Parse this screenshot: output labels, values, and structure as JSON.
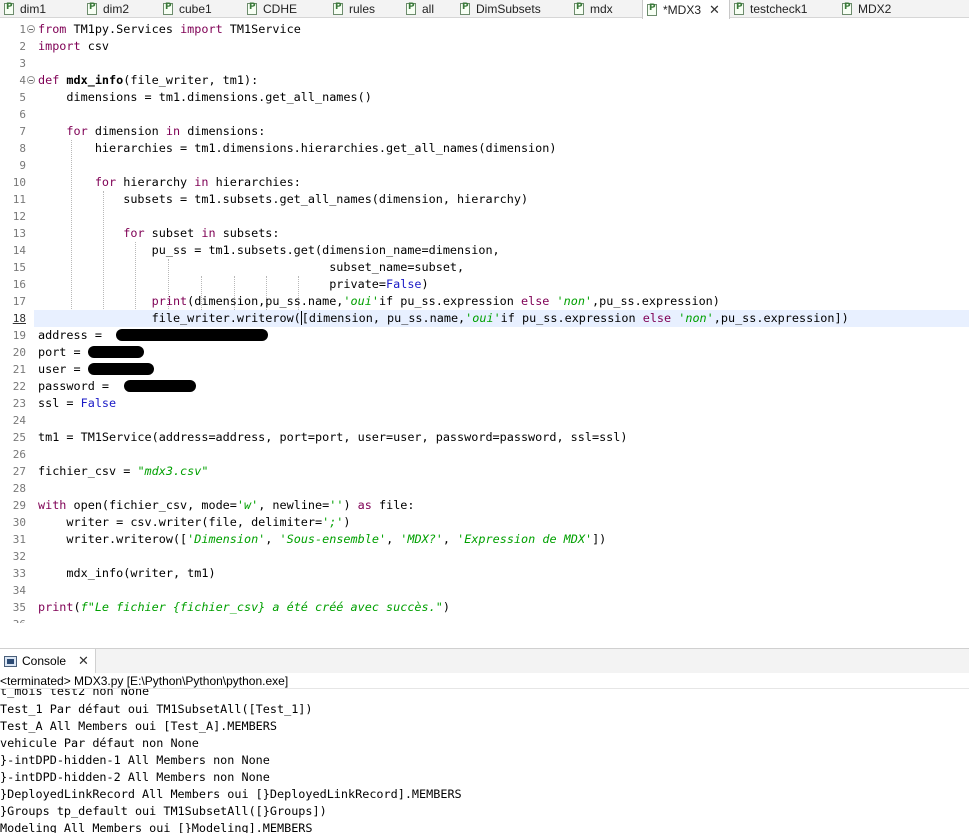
{
  "tabs": [
    {
      "label": "dim1",
      "active": false
    },
    {
      "label": "dim2",
      "active": false
    },
    {
      "label": "cube1",
      "active": false
    },
    {
      "label": "CDHE",
      "active": false
    },
    {
      "label": "rules",
      "active": false
    },
    {
      "label": "all",
      "active": false
    },
    {
      "label": "DimSubsets",
      "active": false
    },
    {
      "label": "mdx",
      "active": false
    },
    {
      "label": "*MDX3",
      "active": true
    },
    {
      "label": "testcheck1",
      "active": false
    },
    {
      "label": "MDX2",
      "active": false
    }
  ],
  "editor": {
    "line_numbers": [
      "1",
      "2",
      "3",
      "4",
      "5",
      "6",
      "7",
      "8",
      "9",
      "10",
      "11",
      "12",
      "13",
      "14",
      "15",
      "16",
      "17",
      "18",
      "19",
      "20",
      "21",
      "22",
      "23",
      "24",
      "25",
      "26",
      "27",
      "28",
      "29",
      "30",
      "31",
      "32",
      "33",
      "34",
      "35",
      "36"
    ],
    "current_line": "18",
    "code": {
      "l1": {
        "kw_from": "from",
        "mod": " TM1py.Services ",
        "kw_import": "import",
        "name": " TM1Service"
      },
      "l2": {
        "kw_import": "import",
        "name": " csv"
      },
      "l4": {
        "kw_def": "def",
        "fname": "mdx_info",
        "params": "(file_writer, tm1):"
      },
      "l5": {
        "text": "    dimensions = tm1.dimensions.get_all_names()"
      },
      "l7": {
        "indent": "    ",
        "kw_for": "for",
        "a": " dimension ",
        "kw_in": "in",
        "b": " dimensions:"
      },
      "l8": {
        "text": "        hierarchies = tm1.dimensions.hierarchies.get_all_names(dimension)"
      },
      "l10": {
        "indent": "        ",
        "kw_for": "for",
        "a": " hierarchy ",
        "kw_in": "in",
        "b": " hierarchies:"
      },
      "l11": {
        "text": "            subsets = tm1.subsets.get_all_names(dimension, hierarchy)"
      },
      "l13": {
        "indent": "            ",
        "kw_for": "for",
        "a": " subset ",
        "kw_in": "in",
        "b": " subsets:"
      },
      "l14": {
        "text": "                pu_ss = tm1.subsets.get(dimension_name=dimension,"
      },
      "l15": {
        "text": "                                         subset_name=subset,"
      },
      "l16": {
        "pre": "                                         private=",
        "val": "False",
        "post": ")"
      },
      "l17": {
        "indent": "                ",
        "kw_print": "print",
        "a": "(dimension,pu_ss.name,",
        "s1": "'oui'",
        "b": "if pu_ss.expression ",
        "kw_else": "else",
        "c": " ",
        "s2": "'non'",
        "d": ",pu_ss.expression)"
      },
      "l18": {
        "a": "                file_writer.writerow(",
        "b": "[dimension, pu_ss.name,",
        "s1": "'oui'",
        "c": "if pu_ss.expression ",
        "kw_else": "else",
        "d": " ",
        "s2": "'non'",
        "e": ",pu_ss.expression])"
      },
      "l19": {
        "text": "address = "
      },
      "l20": {
        "text": "port ="
      },
      "l21": {
        "text": "user ="
      },
      "l22": {
        "text": "password = "
      },
      "l23": {
        "a": "ssl = ",
        "val": "False"
      },
      "l25": {
        "text": "tm1 = TM1Service(address=address, port=port, user=user, password=password, ssl=ssl)"
      },
      "l27": {
        "a": "fichier_csv = ",
        "s": "\"mdx3.csv\""
      },
      "l29": {
        "kw_with": "with",
        "a": " open(fichier_csv, mode=",
        "s1": "'w'",
        "b": ", newline=",
        "s2": "''",
        "c": ") ",
        "kw_as": "as",
        "d": " file:"
      },
      "l30": {
        "a": "    writer = csv.writer(file, delimiter=",
        "s": "';'",
        "b": ")"
      },
      "l31": {
        "a": "    writer.writerow([",
        "s1": "'Dimension'",
        "c1": ", ",
        "s2": "'Sous-ensemble'",
        "c2": ", ",
        "s3": "'MDX?'",
        "c3": ", ",
        "s4": "'Expression de MDX'",
        "b": "])"
      },
      "l33": {
        "text": "    mdx_info(writer, tm1)"
      },
      "l35": {
        "kw_print": "print",
        "a": "(",
        "s": "f\"Le fichier {fichier_csv} a été créé avec succès.\"",
        "b": ")"
      }
    }
  },
  "console": {
    "tab_label": "Console",
    "status": "<terminated> MDX3.py [E:\\Python\\Python\\python.exe]",
    "output": [
      "t_mois test2 non None",
      "Test_1 Par défaut oui TM1SubsetAll([Test_1])",
      "Test_A All Members oui [Test_A].MEMBERS",
      "vehicule Par défaut non None",
      "}-intDPD-hidden-1 All Members non None",
      "}-intDPD-hidden-2 All Members non None",
      "}DeployedLinkRecord All Members oui [}DeployedLinkRecord].MEMBERS",
      "}Groups tp_default oui TM1SubsetAll([}Groups])",
      "Modeling All Members oui [}Modeling].MEMBERS"
    ]
  },
  "colors": {
    "keyword": "#7f0055",
    "string": "#00a000",
    "builtin": "#1a1ac6",
    "current_line_bg": "#e8f0ff"
  }
}
